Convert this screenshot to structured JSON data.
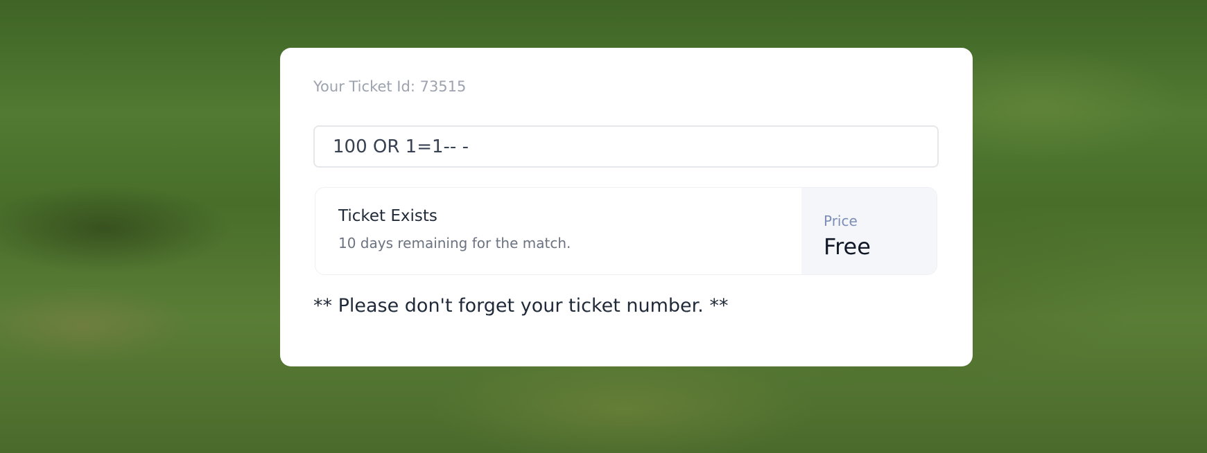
{
  "ticket": {
    "id_label": "Your Ticket Id: 73515",
    "input_value": "100 OR 1=1-- -"
  },
  "result": {
    "title": "Ticket Exists",
    "subtitle": "10 days remaining for the match.",
    "price_label": "Price",
    "price_value": "Free"
  },
  "reminder": "** Please don't forget your ticket number. **",
  "colors": {
    "card_background": "#ffffff",
    "price_panel_background": "#f4f6fa",
    "price_label": "#7c8db5",
    "muted_text": "#9ca3af"
  }
}
